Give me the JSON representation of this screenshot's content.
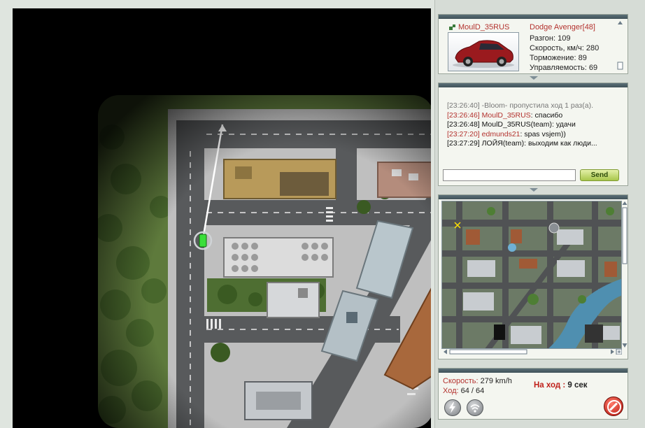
{
  "player": {
    "name": "MoulD_35RUS",
    "car_name": "Dodge Avenger[48]",
    "stats": [
      {
        "label": "Разгон",
        "value": "109"
      },
      {
        "label": "Скорость, км/ч",
        "value": "280"
      },
      {
        "label": "Торможение",
        "value": "89"
      },
      {
        "label": "Управляемость",
        "value": "69"
      }
    ]
  },
  "chat": {
    "lines": [
      {
        "time": "[23:26:40]",
        "name": "-Bloom-",
        "text": " пропустила ход 1 раз(а).",
        "system": true
      },
      {
        "time": "[23:26:46]",
        "name": "MoulD_35RUS",
        "text": ": спасибо",
        "system": false,
        "red": true
      },
      {
        "time": "[23:26:48]",
        "name": "MoulD_35RUS(team)",
        "text": ": удачи",
        "system": false,
        "red": false
      },
      {
        "time": "[23:27:20]",
        "name": "edmunds21",
        "text": ": spas vsjem))",
        "system": false,
        "red": true
      },
      {
        "time": "[23:27:29]",
        "name": "ЛОЙЯ(team)",
        "text": ": выходим как люди...",
        "system": false,
        "red": false
      }
    ],
    "input_value": "",
    "send_label": "Send"
  },
  "status": {
    "speed_label": "Скорость:",
    "speed_value": "279 km/h",
    "moves_label": "Ход:",
    "moves_value": "64 / 64",
    "turn_label": "На ход :",
    "turn_value": "9 сек"
  },
  "icons": {
    "nitro": "lightning-icon",
    "signal": "signal-icon",
    "stop": "stop-icon",
    "player": "player-icon"
  },
  "colors": {
    "accent_red": "#b3322e",
    "send_green": "#a8c64a",
    "player_car": "#3adf3a"
  }
}
